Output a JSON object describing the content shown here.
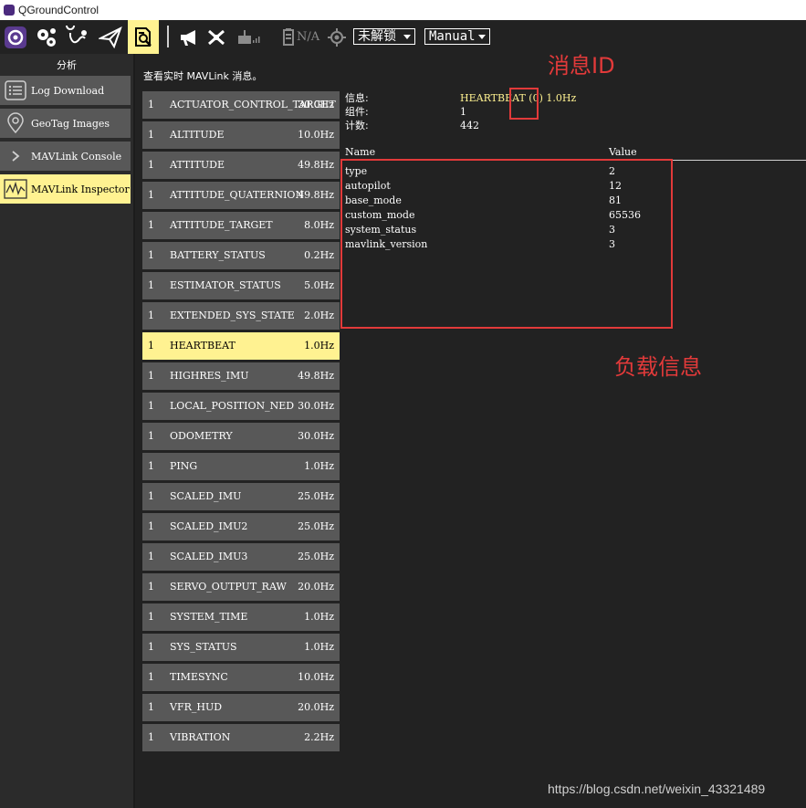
{
  "window": {
    "title": "QGroundControl"
  },
  "toolbar": {
    "lock_dropdown": "未解锁",
    "mode_dropdown": "Manual",
    "gps_na": "N/A"
  },
  "sidebar": {
    "section_title": "分析",
    "items": [
      {
        "label": "Log Download",
        "icon": "list-icon",
        "active": false
      },
      {
        "label": "GeoTag Images",
        "icon": "map-pin-icon",
        "active": false
      },
      {
        "label": "MAVLink Console",
        "icon": "chevron-right-icon",
        "active": false
      },
      {
        "label": "MAVLink Inspector",
        "icon": "waveform-icon",
        "active": true
      }
    ]
  },
  "main": {
    "instruction": "查看实时 MAVLink 消息。",
    "messages": [
      {
        "comp": "1",
        "name": "ACTUATOR_CONTROL_TARGET",
        "rate": "30.0Hz",
        "active": false
      },
      {
        "comp": "1",
        "name": "ALTITUDE",
        "rate": "10.0Hz",
        "active": false
      },
      {
        "comp": "1",
        "name": "ATTITUDE",
        "rate": "49.8Hz",
        "active": false
      },
      {
        "comp": "1",
        "name": "ATTITUDE_QUATERNION",
        "rate": "49.8Hz",
        "active": false
      },
      {
        "comp": "1",
        "name": "ATTITUDE_TARGET",
        "rate": "8.0Hz",
        "active": false
      },
      {
        "comp": "1",
        "name": "BATTERY_STATUS",
        "rate": "0.2Hz",
        "active": false
      },
      {
        "comp": "1",
        "name": "ESTIMATOR_STATUS",
        "rate": "5.0Hz",
        "active": false
      },
      {
        "comp": "1",
        "name": "EXTENDED_SYS_STATE",
        "rate": "2.0Hz",
        "active": false
      },
      {
        "comp": "1",
        "name": "HEARTBEAT",
        "rate": "1.0Hz",
        "active": true
      },
      {
        "comp": "1",
        "name": "HIGHRES_IMU",
        "rate": "49.8Hz",
        "active": false
      },
      {
        "comp": "1",
        "name": "LOCAL_POSITION_NED",
        "rate": "30.0Hz",
        "active": false
      },
      {
        "comp": "1",
        "name": "ODOMETRY",
        "rate": "30.0Hz",
        "active": false
      },
      {
        "comp": "1",
        "name": "PING",
        "rate": "1.0Hz",
        "active": false
      },
      {
        "comp": "1",
        "name": "SCALED_IMU",
        "rate": "25.0Hz",
        "active": false
      },
      {
        "comp": "1",
        "name": "SCALED_IMU2",
        "rate": "25.0Hz",
        "active": false
      },
      {
        "comp": "1",
        "name": "SCALED_IMU3",
        "rate": "25.0Hz",
        "active": false
      },
      {
        "comp": "1",
        "name": "SERVO_OUTPUT_RAW",
        "rate": "20.0Hz",
        "active": false
      },
      {
        "comp": "1",
        "name": "SYSTEM_TIME",
        "rate": "1.0Hz",
        "active": false
      },
      {
        "comp": "1",
        "name": "SYS_STATUS",
        "rate": "1.0Hz",
        "active": false
      },
      {
        "comp": "1",
        "name": "TIMESYNC",
        "rate": "10.0Hz",
        "active": false
      },
      {
        "comp": "1",
        "name": "VFR_HUD",
        "rate": "20.0Hz",
        "active": false
      },
      {
        "comp": "1",
        "name": "VIBRATION",
        "rate": "2.2Hz",
        "active": false
      }
    ],
    "detail": {
      "label_message": "信息:",
      "label_component": "组件:",
      "label_count": "计数:",
      "message_name": "HEARTBEAT",
      "message_id": "(0)",
      "message_rate": "1.0Hz",
      "component": "1",
      "count": "442",
      "col_name": "Name",
      "col_value": "Value",
      "fields": [
        {
          "name": "type",
          "value": "2"
        },
        {
          "name": "autopilot",
          "value": "12"
        },
        {
          "name": "base_mode",
          "value": "81"
        },
        {
          "name": "custom_mode",
          "value": "65536"
        },
        {
          "name": "system_status",
          "value": "3"
        },
        {
          "name": "mavlink_version",
          "value": "3"
        }
      ]
    }
  },
  "annotations": {
    "message_id_label": "消息ID",
    "payload_label": "负载信息",
    "color": "#e23a3a"
  },
  "watermark": "https://blog.csdn.net/weixin_43321489",
  "colors": {
    "active": "#fff291",
    "button": "#585858",
    "background": "#222222"
  }
}
